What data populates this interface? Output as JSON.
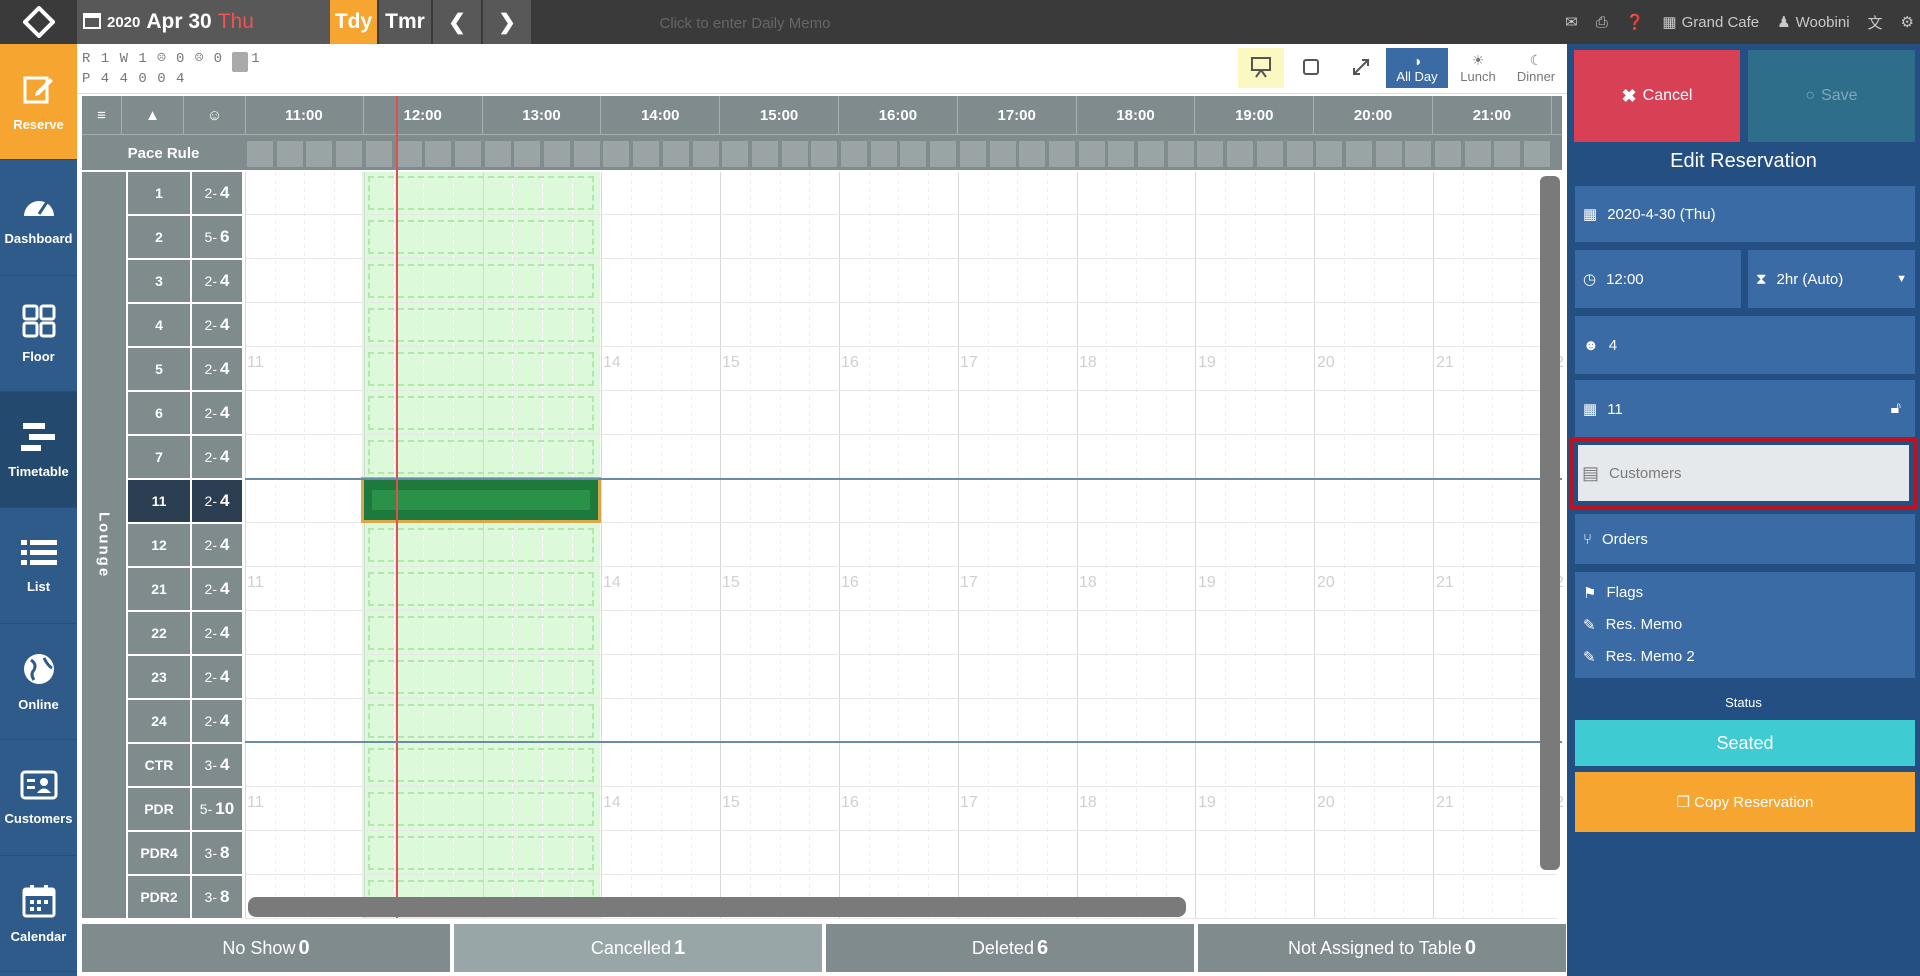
{
  "top": {
    "year": "2020",
    "month_day": "Apr 30",
    "weekday": "Thu",
    "today_label": "Tdy",
    "tomorrow_label": "Tmr",
    "restaurant": "Grand Cafe",
    "user": "Woobini"
  },
  "nav": {
    "reserve": "Reserve",
    "dashboard": "Dashboard",
    "floor": "Floor",
    "timetable": "Timetable",
    "list": "List",
    "online": "Online",
    "customers": "Customers",
    "calendar": "Calendar"
  },
  "counts": {
    "r_line": "R 1 W 1 ☹ 0 ☹ 0 ☹ 1",
    "p_line": "P 4   4   0   0   4"
  },
  "memo": "Click to enter Daily Memo",
  "views": {
    "all_day": "All Day",
    "lunch": "Lunch",
    "dinner": "Dinner"
  },
  "pace_rule": "Pace Rule",
  "hours": [
    "11:00",
    "12:00",
    "13:00",
    "14:00",
    "15:00",
    "16:00",
    "17:00",
    "18:00",
    "19:00",
    "20:00",
    "21:00"
  ],
  "hour_marks": [
    "11",
    "14",
    "15",
    "16",
    "17",
    "18",
    "19",
    "20",
    "21",
    "2"
  ],
  "section": "Lounge",
  "tables": [
    {
      "name": "1",
      "min": "2",
      "max": "4"
    },
    {
      "name": "2",
      "min": "5",
      "max": "6"
    },
    {
      "name": "3",
      "min": "2",
      "max": "4"
    },
    {
      "name": "4",
      "min": "2",
      "max": "4"
    },
    {
      "name": "5",
      "min": "2",
      "max": "4"
    },
    {
      "name": "6",
      "min": "2",
      "max": "4"
    },
    {
      "name": "7",
      "min": "2",
      "max": "4"
    },
    {
      "name": "11",
      "min": "2",
      "max": "4"
    },
    {
      "name": "12",
      "min": "2",
      "max": "4"
    },
    {
      "name": "21",
      "min": "2",
      "max": "4"
    },
    {
      "name": "22",
      "min": "2",
      "max": "4"
    },
    {
      "name": "23",
      "min": "2",
      "max": "4"
    },
    {
      "name": "24",
      "min": "2",
      "max": "4"
    },
    {
      "name": "CTR",
      "min": "3",
      "max": "4"
    },
    {
      "name": "PDR",
      "min": "5",
      "max": "10"
    },
    {
      "name": "PDR4",
      "min": "3",
      "max": "8"
    },
    {
      "name": "PDR2",
      "min": "3",
      "max": "8"
    }
  ],
  "footer": {
    "no_show": "No Show",
    "no_show_count": "0",
    "cancelled": "Cancelled",
    "cancelled_count": "1",
    "deleted": "Deleted",
    "deleted_count": "6",
    "not_assigned": "Not Assigned to Table",
    "not_assigned_count": "0"
  },
  "panel": {
    "cancel": "Cancel",
    "save": "Save",
    "title": "Edit Reservation",
    "date": "2020-4-30 (Thu)",
    "time": "12:00",
    "duration": "2hr (Auto)",
    "party": "4",
    "table": "11",
    "customers_placeholder": "Customers",
    "orders": "Orders",
    "flags": "Flags",
    "res_memo": "Res. Memo",
    "res_memo2": "Res. Memo 2",
    "status_label": "Status",
    "status": "Seated",
    "copy": "Copy Reservation"
  },
  "colors": {
    "accent": "#f7a531",
    "nav": "#2f5b8a",
    "panel": "#234f82",
    "cancel": "#d84155",
    "seated": "#3ecbd1",
    "highlight": "#c0111f"
  }
}
